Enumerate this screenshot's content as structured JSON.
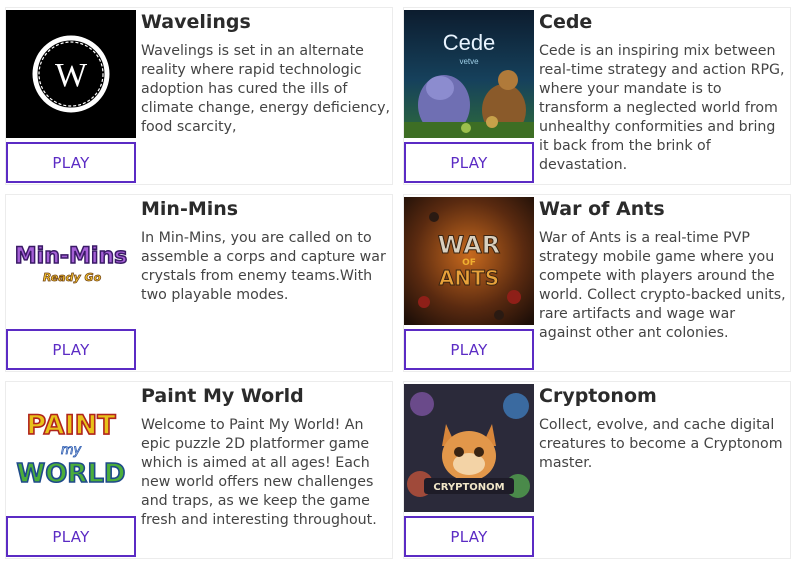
{
  "colors": {
    "accent": "#5b2bc4",
    "border": "#ececec",
    "title": "#2b2b2b",
    "text": "#444444"
  },
  "games": [
    {
      "title": "Wavelings",
      "description": "Wavelings is set in an alternate reality where rapid technologic adoption has cured the ills of climate change, energy deficiency, food scarcity,",
      "play_label": "PLAY",
      "image": {
        "icon": "wavelings-logo-icon",
        "logo_text": "W"
      }
    },
    {
      "title": "Cede",
      "description": "Cede is an inspiring mix between real-time strategy and action RPG, where your mandate is to transform a neglected world from unhealthy conformities and bring it back from the brink of devastation.",
      "play_label": "PLAY",
      "image": {
        "icon": "cede-artwork-icon",
        "logo_text": "Cede",
        "logo_subtext": "vetve"
      }
    },
    {
      "title": "Min-Mins",
      "description": "In Min-Mins, you are called on to assemble a corps and capture war crystals from enemy teams.With two playable modes.",
      "play_label": "PLAY",
      "image": {
        "icon": "min-mins-logo-icon",
        "logo_text": "Min-Mins",
        "logo_subtext": "Ready Go"
      }
    },
    {
      "title": "War of Ants",
      "description": "War of Ants is a real-time PVP strategy mobile game where you compete with players around the world. Collect crypto-backed units, rare artifacts and wage war against other ant colonies.",
      "play_label": "PLAY",
      "image": {
        "icon": "war-of-ants-artwork-icon",
        "logo_line1": "WAR",
        "logo_line2": "OF",
        "logo_line3": "ANTS"
      }
    },
    {
      "title": "Paint My World",
      "description": "Welcome to Paint My World! An epic puzzle 2D platformer game which is aimed at all ages! Each new world offers new challenges and traps, as we keep the game fresh and interesting throughout.",
      "play_label": "PLAY",
      "image": {
        "icon": "paint-my-world-logo-icon",
        "logo_line1": "PAINT",
        "logo_line2": "my",
        "logo_line3": "WORLD"
      }
    },
    {
      "title": "Cryptonom",
      "description": "Collect, evolve, and cache digital creatures to become a Cryptonom master.",
      "play_label": "PLAY",
      "image": {
        "icon": "cryptonom-artwork-icon",
        "logo_text": "CRYPTONOM"
      }
    }
  ]
}
